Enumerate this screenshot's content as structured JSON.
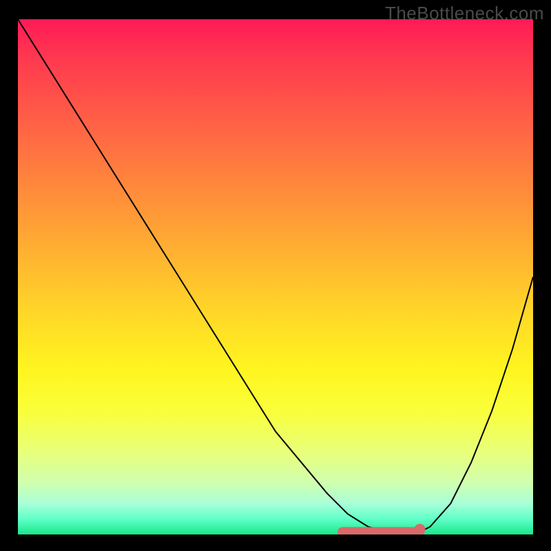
{
  "watermark": "TheBottleneck.com",
  "chart_data": {
    "type": "line",
    "title": "",
    "xlabel": "",
    "ylabel": "",
    "xlim": [
      0,
      100
    ],
    "ylim": [
      0,
      100
    ],
    "x": [
      0,
      5,
      10,
      15,
      20,
      25,
      30,
      35,
      40,
      45,
      50,
      55,
      60,
      64,
      68,
      72,
      76,
      78,
      80,
      84,
      88,
      92,
      96,
      100
    ],
    "values": [
      100,
      92,
      84,
      76,
      68,
      60,
      52,
      44,
      36,
      28,
      20,
      14,
      8,
      4,
      1.5,
      0.5,
      0.3,
      0.5,
      1.5,
      6,
      14,
      24,
      36,
      50
    ],
    "highlight_range": {
      "x_start": 63,
      "x_end": 78,
      "y": 0.5
    },
    "highlight_point": {
      "x": 78,
      "y": 1
    },
    "gradient_stops": [
      {
        "offset": 0,
        "color": "#ff1a57"
      },
      {
        "offset": 50,
        "color": "#ffda27"
      },
      {
        "offset": 100,
        "color": "#18e88a"
      }
    ]
  }
}
